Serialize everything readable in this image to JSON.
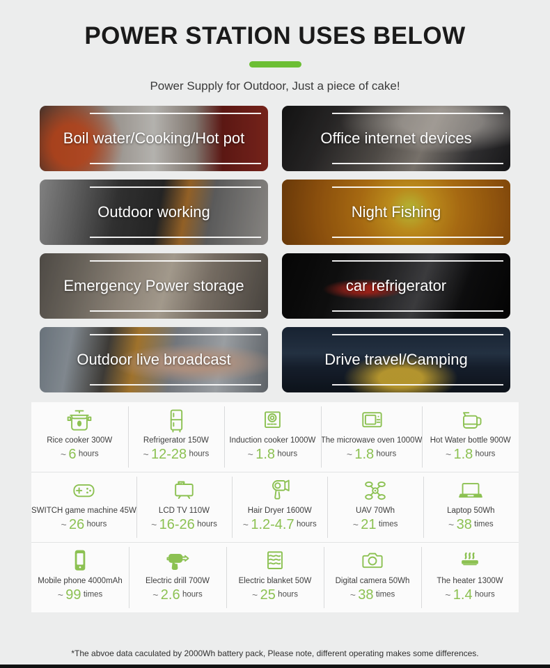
{
  "header": {
    "title": "POWER STATION USES BELOW",
    "subtitle": "Power Supply for Outdoor, Just a piece of cake!",
    "accent_color": "#6cbe34"
  },
  "use_cases": [
    {
      "label": "Boil water/Cooking/Hot pot",
      "art": "bg-boil",
      "icon": "cooking-photo"
    },
    {
      "label": "Office internet devices",
      "art": "bg-office",
      "icon": "office-photo"
    },
    {
      "label": "Outdoor working",
      "art": "bg-outdoor",
      "icon": "drill-photo"
    },
    {
      "label": "Night Fishing",
      "art": "bg-night",
      "icon": "fishing-photo"
    },
    {
      "label": "Emergency Power storage",
      "art": "bg-emergency",
      "icon": "warehouse-photo"
    },
    {
      "label": "car refrigerator",
      "art": "bg-car",
      "icon": "car-fridge-photo"
    },
    {
      "label": "Outdoor live broadcast",
      "art": "bg-broadcast",
      "icon": "broadcast-photo"
    },
    {
      "label": "Drive travel/Camping",
      "art": "bg-camping",
      "icon": "camping-photo"
    }
  ],
  "appliances": [
    [
      {
        "icon": "rice-cooker-icon",
        "name": "Rice cooker 300W",
        "tilde": "~",
        "value": "6",
        "unit": "hours"
      },
      {
        "icon": "refrigerator-icon",
        "name": "Refrigerator 150W",
        "tilde": "~",
        "value": "12-28",
        "unit": "hours"
      },
      {
        "icon": "induction-cooker-icon",
        "name": "Induction cooker 1000W",
        "tilde": "~",
        "value": "1.8",
        "unit": "hours"
      },
      {
        "icon": "microwave-icon",
        "name": "The microwave oven 1000W",
        "tilde": "~",
        "value": "1.8",
        "unit": "hours"
      },
      {
        "icon": "kettle-icon",
        "name": "Hot Water bottle 900W",
        "tilde": "~",
        "value": "1.8",
        "unit": "hours"
      }
    ],
    [
      {
        "icon": "game-controller-icon",
        "name": "SWITCH game machine 45W",
        "tilde": "~",
        "value": "26",
        "unit": "hours"
      },
      {
        "icon": "tv-icon",
        "name": "LCD TV 110W",
        "tilde": "~",
        "value": "16-26",
        "unit": "hours"
      },
      {
        "icon": "hair-dryer-icon",
        "name": "Hair Dryer 1600W",
        "tilde": "~",
        "value": "1.2-4.7",
        "unit": "hours"
      },
      {
        "icon": "drone-icon",
        "name": "UAV 70Wh",
        "tilde": "~",
        "value": "21",
        "unit": "times"
      },
      {
        "icon": "laptop-icon",
        "name": "Laptop 50Wh",
        "tilde": "~",
        "value": "38",
        "unit": "times"
      }
    ],
    [
      {
        "icon": "mobile-phone-icon",
        "name": "Mobile phone 4000mAh",
        "tilde": "~",
        "value": "99",
        "unit": "times"
      },
      {
        "icon": "electric-drill-icon",
        "name": "Electric drill 700W",
        "tilde": "~",
        "value": "2.6",
        "unit": "hours"
      },
      {
        "icon": "electric-blanket-icon",
        "name": "Electric blanket 50W",
        "tilde": "~",
        "value": "25",
        "unit": "hours"
      },
      {
        "icon": "digital-camera-icon",
        "name": "Digital camera 50Wh",
        "tilde": "~",
        "value": "38",
        "unit": "times"
      },
      {
        "icon": "heater-icon",
        "name": "The heater 1300W",
        "tilde": "~",
        "value": "1.4",
        "unit": "hours"
      }
    ]
  ],
  "footnote": "*The abvoe data caculated by 2000Wh battery pack, Please note, different operating makes some differences.",
  "colors": {
    "green": "#8cc152",
    "accent": "#6cbe34",
    "page_bg": "#eceded",
    "grid_bg": "#fbfbfb"
  }
}
